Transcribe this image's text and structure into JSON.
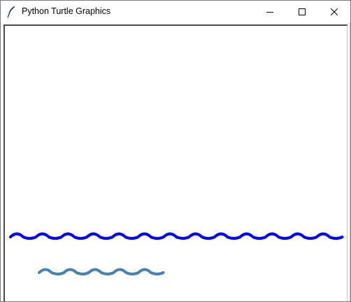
{
  "window": {
    "title": "Python Turtle Graphics",
    "icon": "feather-icon",
    "controls": {
      "minimize": "minimize-icon",
      "maximize": "maximize-icon",
      "close": "close-icon"
    }
  },
  "canvas": {
    "background": "#ffffff",
    "waves": [
      {
        "color": "#0000ff",
        "bumps": 13
      },
      {
        "color": "#4682b4",
        "bumps": 5
      }
    ]
  }
}
